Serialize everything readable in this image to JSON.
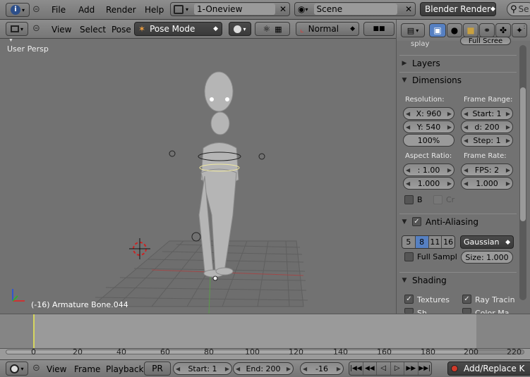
{
  "topbar": {
    "menus": [
      "File",
      "Add",
      "Render",
      "Help"
    ],
    "screen_layout": "1-Oneview",
    "scene": "Scene",
    "engine": "Blender Render",
    "search_placeholder": "Se"
  },
  "view_header": {
    "menus": [
      "View",
      "Select",
      "Pose"
    ],
    "mode": "Pose Mode",
    "orientation": "Normal"
  },
  "viewport": {
    "view_label": "User Persp",
    "status": "(-16) Armature Bone.044"
  },
  "properties": {
    "partial_top": "Full Scree",
    "partial_top_left": "splay",
    "layers_label": "Layers",
    "dimensions_label": "Dimensions",
    "resolution_label": "Resolution:",
    "res_x": "X: 960",
    "res_y": "Y: 540",
    "res_pct": "100%",
    "frame_range_label": "Frame Range:",
    "start": "Start: 1",
    "end": "d: 200",
    "step": "Step: 1",
    "aspect_label": "Aspect Ratio:",
    "aspect_x": ": 1.00",
    "aspect_y": "1.000",
    "frame_rate_label": "Frame Rate:",
    "fps": "FPS: 2",
    "fps_base": "1.000",
    "border_label": "B",
    "crop_label": "Cr",
    "aa_label": "Anti-Aliasing",
    "aa_samples": [
      "5",
      "8",
      "11",
      "16"
    ],
    "aa_selected": "8",
    "aa_filter": "Gaussian",
    "full_sample": "Full Sampl",
    "aa_size": "Size: 1.000",
    "shading_label": "Shading",
    "textures": "Textures",
    "raytracing": "Ray Tracin",
    "partial_row_a": "Sh",
    "partial_row_b": "Color Ma"
  },
  "timeline": {
    "ticks": [
      "0",
      "20",
      "40",
      "60",
      "80",
      "100",
      "120",
      "140",
      "160",
      "180",
      "200",
      "220"
    ],
    "current_frame": -16
  },
  "bottombar": {
    "menus": [
      "View",
      "Frame",
      "Playback"
    ],
    "pr": "PR",
    "start": "Start: 1",
    "end": "End: 200",
    "current": "-16",
    "keying": "Add/Replace K"
  },
  "colors": {
    "accent_blue": "#5680c2",
    "frame_line": "#d6d660",
    "grid": "#6a6a6a"
  }
}
